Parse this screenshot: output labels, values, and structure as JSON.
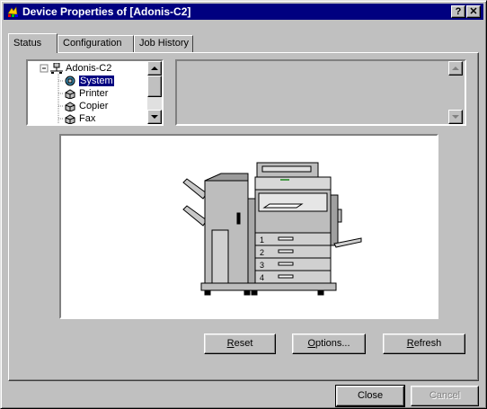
{
  "window": {
    "title": "Device Properties of [Adonis-C2]",
    "help_label": "?",
    "close_label": "✕"
  },
  "tabs": [
    {
      "label": "Status",
      "active": true
    },
    {
      "label": "Configuration",
      "active": false
    },
    {
      "label": "Job History",
      "active": false
    }
  ],
  "tree": {
    "root": "Adonis-C2",
    "items": [
      {
        "label": "System",
        "selected": true
      },
      {
        "label": "Printer",
        "selected": false
      },
      {
        "label": "Copier",
        "selected": false
      },
      {
        "label": "Fax",
        "selected": false
      }
    ]
  },
  "device_image": {
    "tray_labels": [
      "1",
      "2",
      "3",
      "4"
    ]
  },
  "buttons": {
    "reset": {
      "first": "R",
      "rest": "eset"
    },
    "options": {
      "first": "O",
      "rest": "ptions..."
    },
    "refresh": {
      "first": "R",
      "rest": "efresh"
    },
    "close": "Close",
    "cancel": "Cancel"
  },
  "colors": {
    "titlebar": "#000080",
    "face": "#c0c0c0",
    "selection": "#000080"
  }
}
